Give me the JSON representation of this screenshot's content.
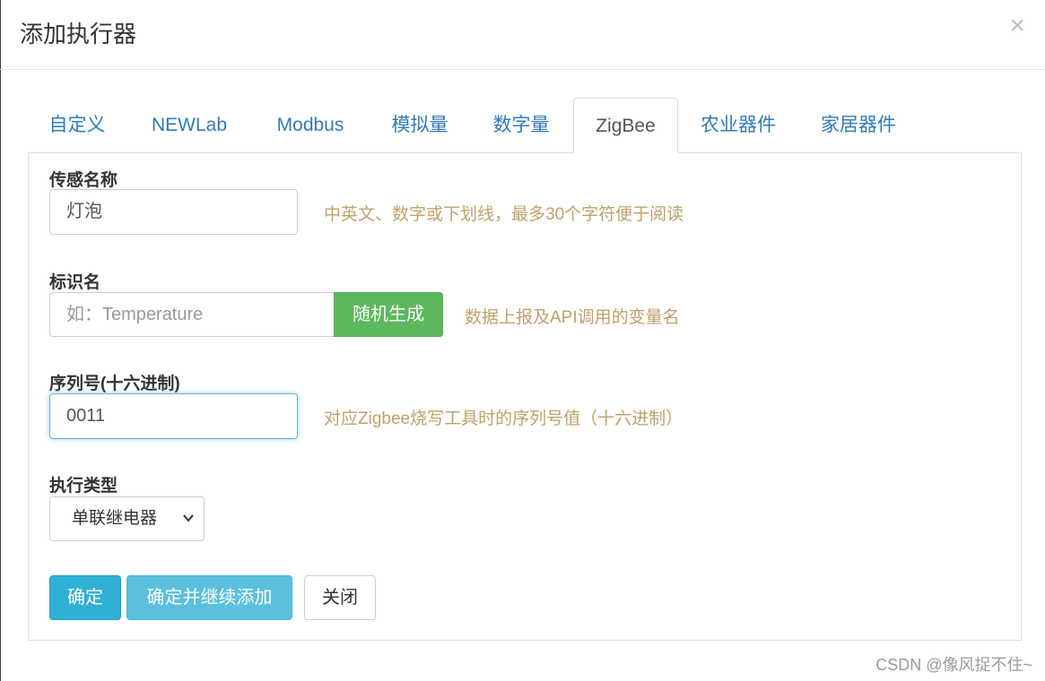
{
  "modal": {
    "title": "添加执行器",
    "close_label": "×"
  },
  "tabs": [
    {
      "label": "自定义",
      "active": false
    },
    {
      "label": "NEWLab",
      "active": false
    },
    {
      "label": "Modbus",
      "active": false
    },
    {
      "label": "模拟量",
      "active": false
    },
    {
      "label": "数字量",
      "active": false
    },
    {
      "label": "ZigBee",
      "active": true
    },
    {
      "label": "农业器件",
      "active": false
    },
    {
      "label": "家居器件",
      "active": false
    }
  ],
  "form": {
    "sensor_name": {
      "label": "传感名称",
      "value": "灯泡",
      "help": "中英文、数字或下划线，最多30个字符便于阅读"
    },
    "identifier": {
      "label": "标识名",
      "placeholder": "如：Temperature",
      "value": "",
      "button_label": "随机生成",
      "help": "数据上报及API调用的变量名"
    },
    "serial": {
      "label": "序列号(十六进制)",
      "value": "0011",
      "help": "对应Zigbee烧写工具时的序列号值（十六进制）"
    },
    "exec_type": {
      "label": "执行类型",
      "selected": "单联继电器"
    }
  },
  "buttons": {
    "ok": "确定",
    "ok_continue": "确定并继续添加",
    "close": "关闭"
  },
  "watermark": "CSDN @像风捉不住~",
  "colors": {
    "link": "#337ab7",
    "help_text": "#c0a16b",
    "success": "#5cb85c",
    "info": "#5bc0de",
    "info_dark": "#31b0d5",
    "focus": "#66afe9"
  }
}
